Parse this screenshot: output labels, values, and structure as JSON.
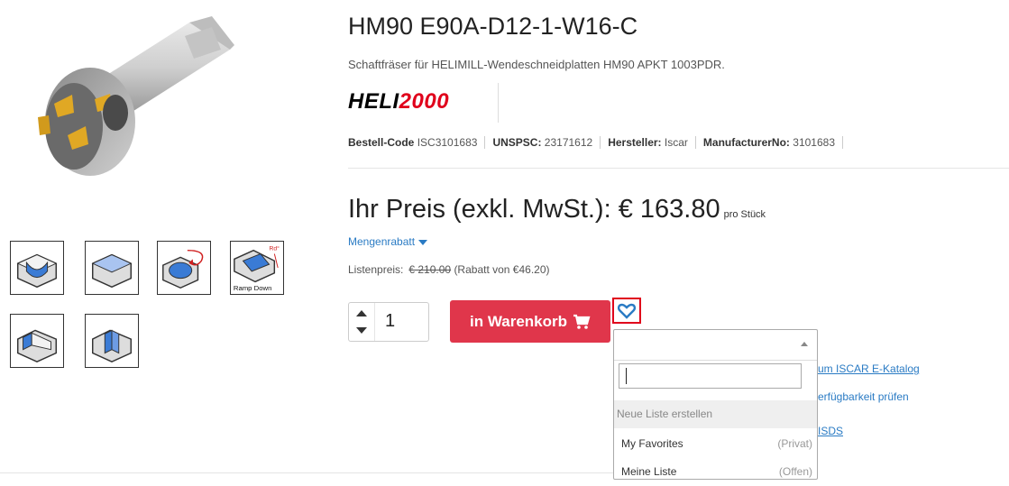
{
  "product": {
    "title": "HM90 E90A-D12-1-W16-C",
    "subtitle": "Schaftfräser für HELIMILL-Wendeschneidplatten HM90 APKT 1003PDR.",
    "brand_logo_text": "HELI2000",
    "brand_colors": {
      "primary": "#000000",
      "accent": "#e0001b"
    }
  },
  "codes": [
    {
      "label": "Bestell-Code",
      "value": "ISC3101683"
    },
    {
      "label": "UNSPSC:",
      "value": "23171612"
    },
    {
      "label": "Hersteller:",
      "value": "Iscar"
    },
    {
      "label": "ManufacturerNo:",
      "value": "3101683"
    }
  ],
  "price": {
    "label": "Ihr Preis (exkl. MwSt.): € 163.80",
    "unit": "pro Stück",
    "volume_discount": "Mengenrabatt",
    "list_price_label": "Listenpreis:",
    "list_price_value": "€ 210.00",
    "discount_note": "(Rabatt von €46.20)"
  },
  "cart": {
    "quantity": "1",
    "button_label": "in Warenkorb",
    "button_color": "#e0364b",
    "icon": "shopping-cart-icon"
  },
  "wishlist": {
    "icon": "heart-icon",
    "highlight_color": "#e0001b",
    "search_value": "",
    "options": [
      {
        "label": "Neue Liste erstellen",
        "tag": ""
      },
      {
        "label": "My Favorites",
        "tag": "(Privat)"
      },
      {
        "label": "Meine Liste",
        "tag": "(Offen)"
      }
    ]
  },
  "links": {
    "catalog": "um ISCAR E-Katalog",
    "availability": "erfügbarkeit prüfen",
    "msds": "ISDS"
  },
  "thumbnails": [
    {
      "icon": "slot-milling-icon",
      "label": ""
    },
    {
      "icon": "face-milling-icon",
      "label": ""
    },
    {
      "icon": "helical-interpolation-icon",
      "label": ""
    },
    {
      "icon": "ramp-down-icon",
      "label": "Ramp Down"
    },
    {
      "icon": "shoulder-milling-icon",
      "label": ""
    },
    {
      "icon": "slotting-icon",
      "label": ""
    }
  ]
}
